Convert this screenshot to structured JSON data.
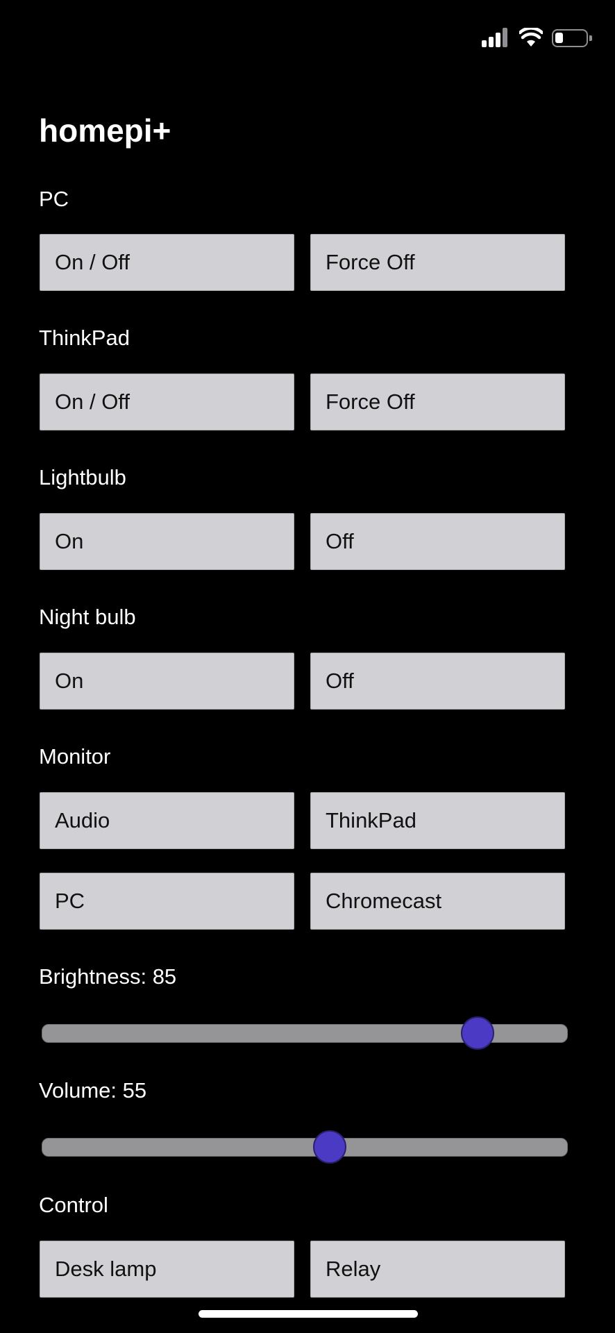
{
  "app": {
    "title": "homepi+"
  },
  "status_bar": {
    "icons": [
      "cellular-signal-icon",
      "wifi-icon",
      "battery-icon"
    ],
    "battery_level": 0.25
  },
  "sections": {
    "pc": {
      "label": "PC",
      "buttons": [
        "On / Off",
        "Force Off"
      ]
    },
    "thinkpad": {
      "label": "ThinkPad",
      "buttons": [
        "On / Off",
        "Force Off"
      ]
    },
    "lightbulb": {
      "label": "Lightbulb",
      "buttons": [
        "On",
        "Off"
      ]
    },
    "night_bulb": {
      "label": "Night bulb",
      "buttons": [
        "On",
        "Off"
      ]
    },
    "monitor": {
      "label": "Monitor",
      "buttons": [
        "Audio",
        "ThinkPad",
        "PC",
        "Chromecast"
      ]
    },
    "brightness": {
      "label": "Brightness: 85",
      "value": 85,
      "min": 0,
      "max": 100
    },
    "volume": {
      "label": "Volume: 55",
      "value": 55,
      "min": 0,
      "max": 100
    },
    "control": {
      "label": "Control",
      "buttons": [
        "Desk lamp",
        "Relay"
      ]
    }
  },
  "colors": {
    "background": "#000000",
    "button_bg": "#d1d0d4",
    "slider_track": "#959497",
    "slider_thumb": "#4b3ac4"
  }
}
